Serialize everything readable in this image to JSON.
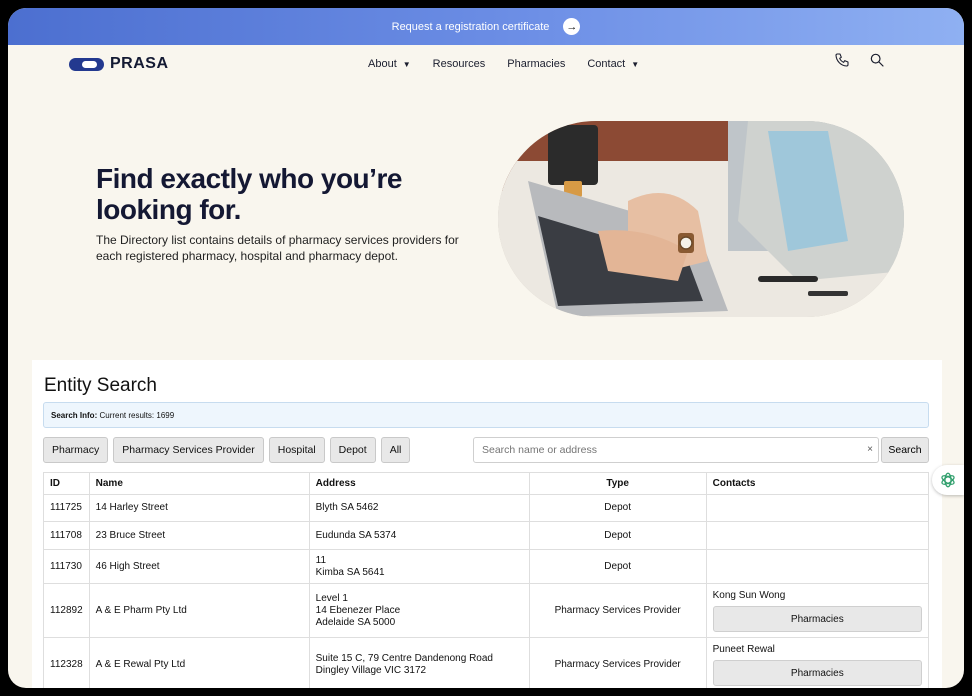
{
  "banner": {
    "text": "Request a registration certificate"
  },
  "brand": {
    "name": "PRASA"
  },
  "nav": {
    "items": [
      {
        "label": "About",
        "dropdown": true
      },
      {
        "label": "Resources",
        "dropdown": false
      },
      {
        "label": "Pharmacies",
        "dropdown": false
      },
      {
        "label": "Contact",
        "dropdown": true
      }
    ]
  },
  "hero": {
    "title": "Find exactly who you’re looking for.",
    "description": "The Directory list contains details of pharmacy services providers for each registered pharmacy, hospital and pharmacy depot."
  },
  "entity_search": {
    "title": "Entity Search",
    "info_label": "Search Info:",
    "info_text": "Current results: 1699",
    "filters": [
      "Pharmacy",
      "Pharmacy Services Provider",
      "Hospital",
      "Depot",
      "All"
    ],
    "search_placeholder": "Search name or address",
    "clear_symbol": "×",
    "search_button": "Search",
    "columns": [
      "ID",
      "Name",
      "Address",
      "Type",
      "Contacts"
    ],
    "rows": [
      {
        "id": "111725",
        "name": "14 Harley Street",
        "address": [
          "Blyth SA 5462"
        ],
        "type": "Depot",
        "contact": "",
        "button": ""
      },
      {
        "id": "111708",
        "name": "23 Bruce Street",
        "address": [
          "Eudunda SA 5374"
        ],
        "type": "Depot",
        "contact": "",
        "button": ""
      },
      {
        "id": "111730",
        "name": "46 High Street",
        "address": [
          "11",
          "Kimba SA 5641"
        ],
        "type": "Depot",
        "contact": "",
        "button": ""
      },
      {
        "id": "112892",
        "name": "A & E Pharm Pty Ltd",
        "address": [
          "Level 1",
          "14 Ebenezer Place",
          "Adelaide SA 5000"
        ],
        "type": "Pharmacy Services Provider",
        "contact": "Kong Sun Wong",
        "button": "Pharmacies"
      },
      {
        "id": "112328",
        "name": "A & E Rewal Pty Ltd",
        "address": [
          "Suite 15 C, 79 Centre Dandenong Road",
          "Dingley Village VIC 3172"
        ],
        "type": "Pharmacy Services Provider",
        "contact": "Puneet Rewal",
        "button": "Pharmacies"
      }
    ]
  },
  "icons": {
    "phone": "phone-icon",
    "search": "search-icon",
    "arrow": "arrow-right-icon",
    "assistant": "assistant-icon"
  },
  "colors": {
    "brand": "#23398f",
    "banner_start": "#4c6fd0",
    "banner_end": "#8fb0f2",
    "assistant": "#2e9e6b"
  }
}
